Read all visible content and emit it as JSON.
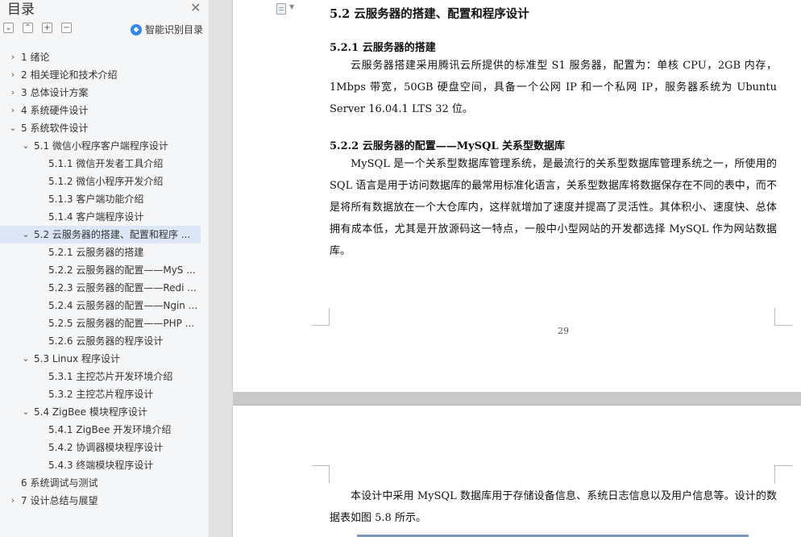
{
  "sidebar": {
    "title": "目录",
    "smart_toc_label": "智能识别目录",
    "toc": [
      {
        "label": "1  绪论",
        "level": 0,
        "caret": "›"
      },
      {
        "label": "2  相关理论和技术介绍",
        "level": 0,
        "caret": "›"
      },
      {
        "label": "3  总体设计方案",
        "level": 0,
        "caret": "›"
      },
      {
        "label": "4  系统硬件设计",
        "level": 0,
        "caret": "›"
      },
      {
        "label": "5  系统软件设计",
        "level": 0,
        "caret": "⌄"
      },
      {
        "label": "5.1  微信小程序客户端程序设计",
        "level": 1,
        "caret": "⌄"
      },
      {
        "label": "5.1.1  微信开发者工具介绍",
        "level": 2,
        "caret": ""
      },
      {
        "label": "5.1.2  微信小程序开发介绍",
        "level": 2,
        "caret": ""
      },
      {
        "label": "5.1.3  客户端功能介绍",
        "level": 2,
        "caret": ""
      },
      {
        "label": "5.1.4  客户端程序设计",
        "level": 2,
        "caret": ""
      },
      {
        "label": "5.2  云服务器的搭建、配置和程序 ...",
        "level": 1,
        "caret": "⌄",
        "selected": true
      },
      {
        "label": "5.2.1  云服务器的搭建",
        "level": 2,
        "caret": ""
      },
      {
        "label": "5.2.2  云服务器的配置——MyS ...",
        "level": 2,
        "caret": ""
      },
      {
        "label": "5.2.3  云服务器的配置——Redi ...",
        "level": 2,
        "caret": ""
      },
      {
        "label": "5.2.4  云服务器的配置——Ngin ...",
        "level": 2,
        "caret": ""
      },
      {
        "label": "5.2.5  云服务器的配置——PHP ...",
        "level": 2,
        "caret": ""
      },
      {
        "label": "5.2.6  云服务器的程序设计",
        "level": 2,
        "caret": ""
      },
      {
        "label": "5.3 Linux 程序设计",
        "level": 1,
        "caret": "⌄"
      },
      {
        "label": "5.3.1  主控芯片开发环境介绍",
        "level": 2,
        "caret": ""
      },
      {
        "label": "5.3.2  主控芯片程序设计",
        "level": 2,
        "caret": ""
      },
      {
        "label": "5.4 ZigBee 模块程序设计",
        "level": 1,
        "caret": "⌄"
      },
      {
        "label": "5.4.1 ZigBee 开发环境介绍",
        "level": 2,
        "caret": ""
      },
      {
        "label": "5.4.2  协调器模块程序设计",
        "level": 2,
        "caret": ""
      },
      {
        "label": "5.4.3  终端模块程序设计",
        "level": 2,
        "caret": ""
      },
      {
        "label": "6  系统调试与测试",
        "level": 0,
        "caret": ""
      },
      {
        "label": "7  设计总结与展望",
        "level": 0,
        "caret": "›"
      }
    ]
  },
  "document": {
    "section_heading": "5.2  云服务器的搭建、配置和程序设计",
    "sub1_heading": "5.2.1  云服务器的搭建",
    "sub1_para": "云服务器搭建采用腾讯云所提供的标准型 S1 服务器，配置为：单核 CPU，2GB 内存，1Mbps 带宽，50GB 硬盘空间，具备一个公网 IP 和一个私网 IP，服务器系统为 Ubuntu Server 16.04.1 LTS 32 位。",
    "sub2_heading": "5.2.2  云服务器的配置——MySQL 关系型数据库",
    "sub2_para": "MySQL 是一个关系型数据库管理系统，是最流行的关系型数据库管理系统之一，所使用的 SQL 语言是用于访问数据库的最常用标准化语言，关系型数据库将数据保存在不同的表中，而不是将所有数据放在一个大仓库内，这样就增加了速度并提高了灵活性。其体积小、速度快、总体拥有成本低，尤其是开放源码这一特点，一般中小型网站的开发都选择 MySQL 作为网站数据库。",
    "page_number": "29",
    "page2_para": "本设计中采用 MySQL 数据库用于存储设备信息、系统日志信息以及用户信息等。设计的数据表如图 5.8 所示。"
  },
  "colors": {
    "selected_bg": "#dde6f7",
    "smart_icon": "#2f86f6",
    "sidebar_bg": "#f5f6f7"
  }
}
